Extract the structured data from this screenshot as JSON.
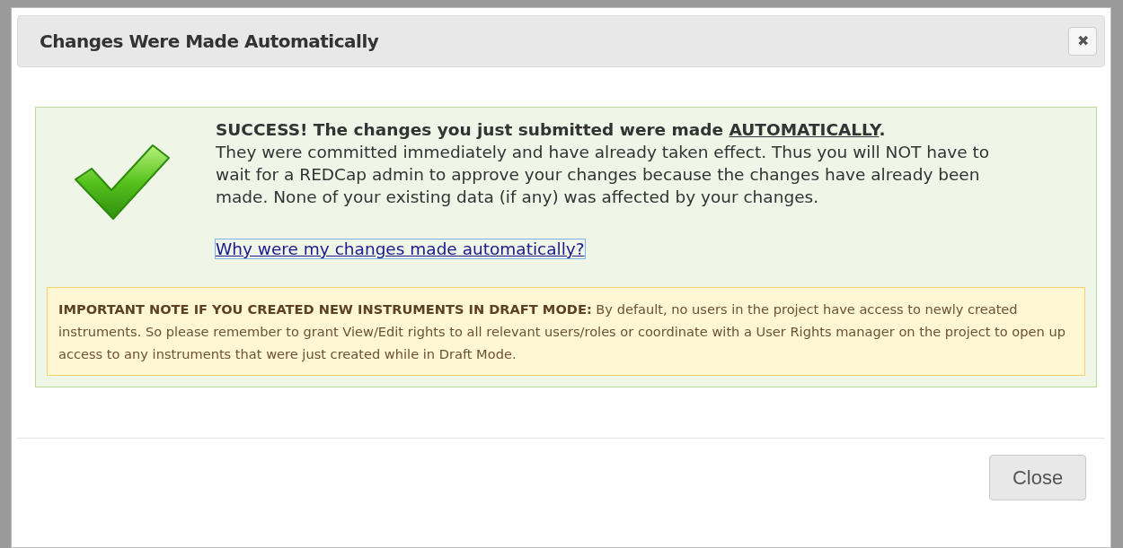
{
  "dialog": {
    "title": "Changes Were Made Automatically",
    "close_icon": "✖"
  },
  "success": {
    "heading": {
      "text": "SUCCESS! The changes you just submitted were made ",
      "emphasis": "AUTOMATICALLY",
      "end": "."
    },
    "body": "They were committed immediately and have already taken effect. Thus you will NOT have to wait for a REDCap admin to approve your changes because the changes have already been made. None of your existing data (if any) was affected by your changes.",
    "link": "Why were my changes made automatically?"
  },
  "note": "**IMPORTANT NOTE IF YOU CREATED NEW INSTRUMENTS IN DRAFT MODE:** By default, no users in the project have access to newly created instruments. So please remember to grant View/Edit rights to all relevant users/roles or coordinate with a User Rights manager on the project to open up access to any instruments that were just created while in Draft Mode.",
  "buttons": [
    "Close"
  ]
}
